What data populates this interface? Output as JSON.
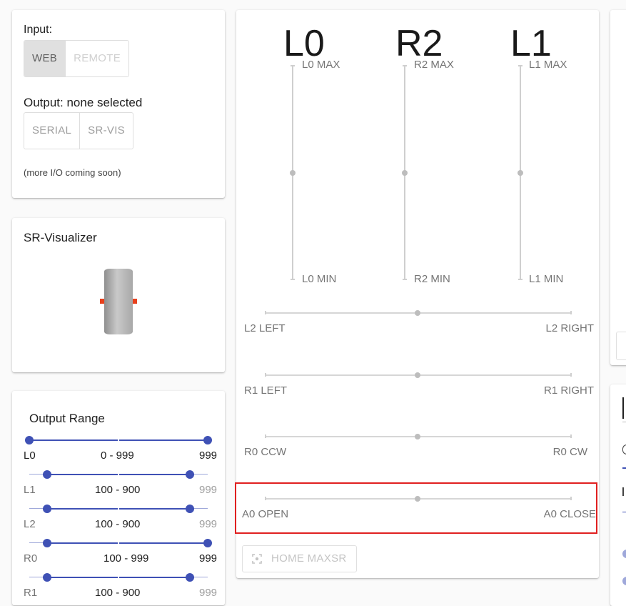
{
  "io": {
    "input_label": "Input:",
    "input_buttons": [
      "WEB",
      "REMOTE"
    ],
    "output_label": "Output: none selected",
    "output_buttons": [
      "SERIAL",
      "SR-VIS"
    ],
    "note": "(more I/O coming soon)"
  },
  "visualizer": {
    "title": "SR-Visualizer"
  },
  "output_range": {
    "title": "Output Range",
    "rows": [
      {
        "name": "L0",
        "range": "0 - 999",
        "max": "999",
        "low": 0,
        "high": 999
      },
      {
        "name": "L1",
        "range": "100 - 900",
        "max": "999",
        "low": 100,
        "high": 900
      },
      {
        "name": "L2",
        "range": "100 - 900",
        "max": "999",
        "low": 100,
        "high": 900
      },
      {
        "name": "R0",
        "range": "100 - 999",
        "max": "999",
        "low": 100,
        "high": 999
      },
      {
        "name": "R1",
        "range": "100 - 900",
        "max": "999",
        "low": 100,
        "high": 900
      }
    ]
  },
  "axes": {
    "vertical": [
      {
        "name": "L0",
        "max_label": "L0 MAX",
        "min_label": "L0 MIN",
        "value": 0.5
      },
      {
        "name": "R2",
        "max_label": "R2 MAX",
        "min_label": "R2 MIN",
        "value": 0.5
      },
      {
        "name": "L1",
        "max_label": "L1 MAX",
        "min_label": "L1 MIN",
        "value": 0.5
      }
    ],
    "horizontal": [
      {
        "left": "L2 LEFT",
        "right": "L2 RIGHT",
        "value": 0.5
      },
      {
        "left": "R1 LEFT",
        "right": "R1 RIGHT",
        "value": 0.5
      },
      {
        "left": "R0 CCW",
        "right": "R0 CW",
        "value": 0.5
      },
      {
        "left": "A0 OPEN",
        "right": "A0 CLOSE",
        "value": 0.5
      }
    ],
    "home_button": "HOME MAXSR"
  },
  "colors": {
    "accent": "#3f51b5",
    "highlight": "#e02020"
  }
}
